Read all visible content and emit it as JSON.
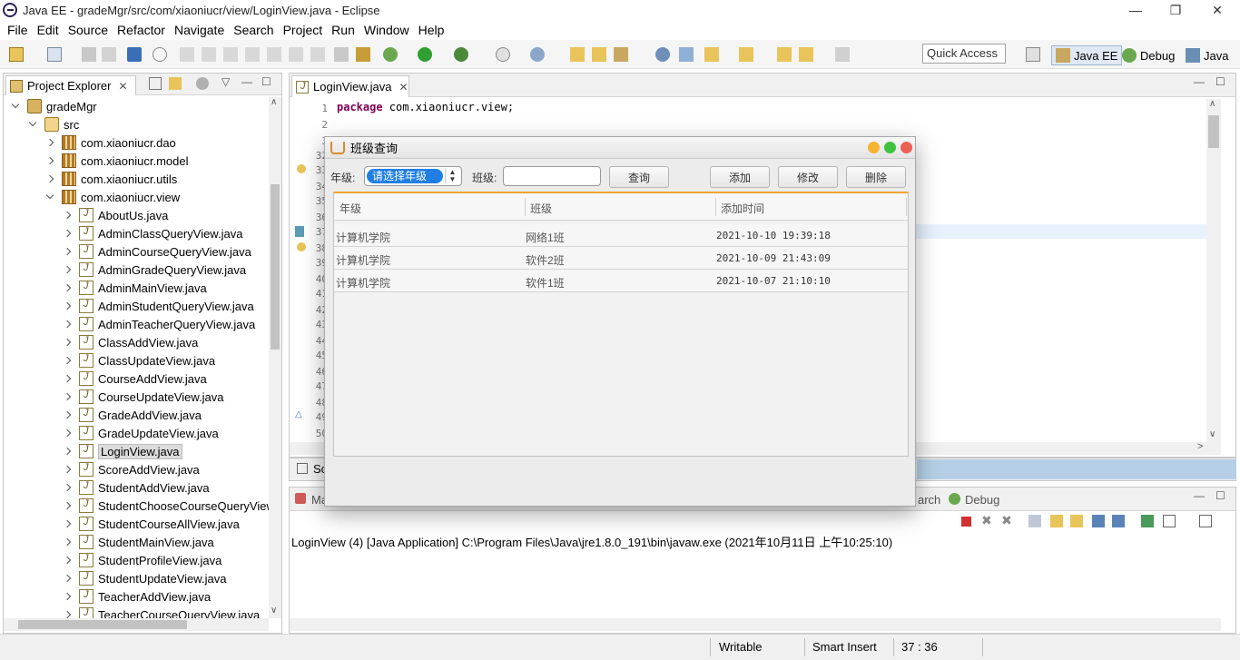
{
  "window": {
    "title": "Java EE - gradeMgr/src/com/xiaoniucr/view/LoginView.java - Eclipse",
    "minimize": "—",
    "restore": "❐",
    "close": "✕"
  },
  "menu": [
    "File",
    "Edit",
    "Source",
    "Refactor",
    "Navigate",
    "Search",
    "Project",
    "Run",
    "Window",
    "Help"
  ],
  "toolbar": {
    "quick_access": "Quick Access",
    "perspectives": [
      "Java EE",
      "Debug",
      "Java"
    ]
  },
  "project_explorer": {
    "tab_label": "Project Explorer",
    "tab_close": "✕",
    "tree": [
      {
        "label": "gradeMgr",
        "indent": 0,
        "expanded": true,
        "icon": "project-icon"
      },
      {
        "label": "src",
        "indent": 1,
        "expanded": true,
        "icon": "source-folder-icon"
      },
      {
        "label": "com.xiaoniucr.dao",
        "indent": 2,
        "expanded": false,
        "icon": "package-icon"
      },
      {
        "label": "com.xiaoniucr.model",
        "indent": 2,
        "expanded": false,
        "icon": "package-icon"
      },
      {
        "label": "com.xiaoniucr.utils",
        "indent": 2,
        "expanded": false,
        "icon": "package-icon"
      },
      {
        "label": "com.xiaoniucr.view",
        "indent": 2,
        "expanded": true,
        "icon": "package-icon"
      },
      {
        "label": "AboutUs.java",
        "indent": 3,
        "expanded": false,
        "icon": "java-file-icon"
      },
      {
        "label": "AdminClassQueryView.java",
        "indent": 3,
        "expanded": false,
        "icon": "java-file-icon"
      },
      {
        "label": "AdminCourseQueryView.java",
        "indent": 3,
        "expanded": false,
        "icon": "java-file-icon"
      },
      {
        "label": "AdminGradeQueryView.java",
        "indent": 3,
        "expanded": false,
        "icon": "java-file-icon"
      },
      {
        "label": "AdminMainView.java",
        "indent": 3,
        "expanded": false,
        "icon": "java-file-icon"
      },
      {
        "label": "AdminStudentQueryView.java",
        "indent": 3,
        "expanded": false,
        "icon": "java-file-icon"
      },
      {
        "label": "AdminTeacherQueryView.java",
        "indent": 3,
        "expanded": false,
        "icon": "java-file-icon"
      },
      {
        "label": "ClassAddView.java",
        "indent": 3,
        "expanded": false,
        "icon": "java-file-icon"
      },
      {
        "label": "ClassUpdateView.java",
        "indent": 3,
        "expanded": false,
        "icon": "java-file-icon"
      },
      {
        "label": "CourseAddView.java",
        "indent": 3,
        "expanded": false,
        "icon": "java-file-icon"
      },
      {
        "label": "CourseUpdateView.java",
        "indent": 3,
        "expanded": false,
        "icon": "java-file-icon"
      },
      {
        "label": "GradeAddView.java",
        "indent": 3,
        "expanded": false,
        "icon": "java-file-icon"
      },
      {
        "label": "GradeUpdateView.java",
        "indent": 3,
        "expanded": false,
        "icon": "java-file-icon"
      },
      {
        "label": "LoginView.java",
        "indent": 3,
        "expanded": false,
        "icon": "java-file-icon",
        "selected": true
      },
      {
        "label": "ScoreAddView.java",
        "indent": 3,
        "expanded": false,
        "icon": "java-file-icon"
      },
      {
        "label": "StudentAddView.java",
        "indent": 3,
        "expanded": false,
        "icon": "java-file-icon"
      },
      {
        "label": "StudentChooseCourseQueryView",
        "indent": 3,
        "expanded": false,
        "icon": "java-file-icon"
      },
      {
        "label": "StudentCourseAllView.java",
        "indent": 3,
        "expanded": false,
        "icon": "java-file-icon"
      },
      {
        "label": "StudentMainView.java",
        "indent": 3,
        "expanded": false,
        "icon": "java-file-icon"
      },
      {
        "label": "StudentProfileView.java",
        "indent": 3,
        "expanded": false,
        "icon": "java-file-icon"
      },
      {
        "label": "StudentUpdateView.java",
        "indent": 3,
        "expanded": false,
        "icon": "java-file-icon"
      },
      {
        "label": "TeacherAddView.java",
        "indent": 3,
        "expanded": false,
        "icon": "java-file-icon"
      },
      {
        "label": "TeacherCourseQueryView.java",
        "indent": 3,
        "expanded": false,
        "icon": "java-file-icon"
      }
    ]
  },
  "editor": {
    "tab_label": "LoginView.java",
    "tab_close": "✕",
    "line_numbers": [
      "1",
      "2",
      "3",
      "32",
      "33",
      "34",
      "35",
      "36",
      "37",
      "38",
      "39",
      "40",
      "41",
      "42",
      "43",
      "44",
      "45",
      "46",
      "47",
      "48",
      "49",
      "50"
    ],
    "code_keyword": "package",
    "code_rest": " com.xiaoniucr.view;"
  },
  "bottom_tabs": {
    "outline_fragment": "Sc",
    "markers_fragment": "Ma",
    "search_fragment": "arch",
    "debug_label": "Debug"
  },
  "console": {
    "launch_line": "LoginView (4) [Java Application] C:\\Program Files\\Java\\jre1.8.0_191\\bin\\javaw.exe (2021年10月11日 上午10:25:10)"
  },
  "status": {
    "writable": "Writable",
    "insert_mode": "Smart Insert",
    "position": "37 : 36"
  },
  "dialog": {
    "title": "班级查询",
    "grade_label": "年级:",
    "grade_selected": "请选择年级",
    "class_label": "班级:",
    "class_value": "",
    "query_button": "查询",
    "add_button": "添加",
    "edit_button": "修改",
    "delete_button": "删除",
    "columns": [
      "年级",
      "班级",
      "添加时间"
    ],
    "rows": [
      [
        "计算机学院",
        "网络1班",
        "2021-10-10 19:39:18"
      ],
      [
        "计算机学院",
        "软件2班",
        "2021-10-09 21:43:09"
      ],
      [
        "计算机学院",
        "软件1班",
        "2021-10-07 21:10:10"
      ]
    ],
    "colors": {
      "close": "#ec5f57",
      "minimize": "#f5b431",
      "maximize": "#3fc23f",
      "accent": "#1f7fe5",
      "header_border": "#f0a433"
    }
  }
}
